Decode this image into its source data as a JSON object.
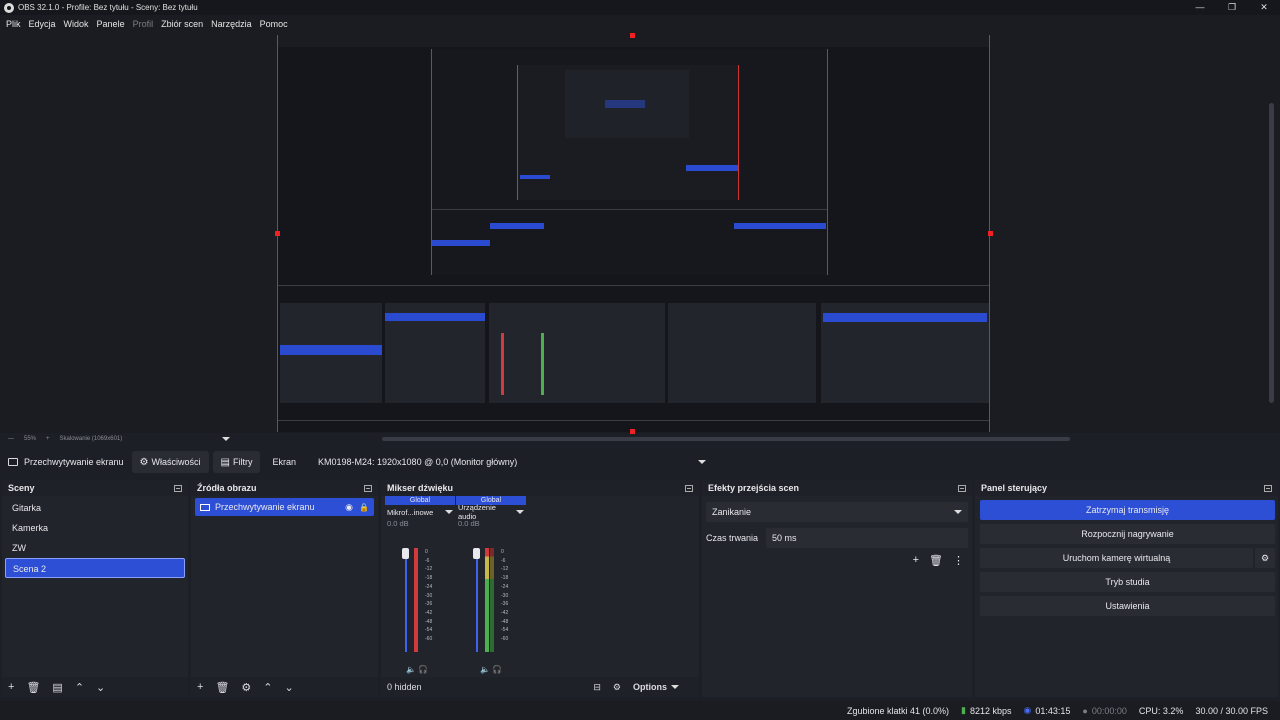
{
  "window": {
    "title": "OBS 32.1.0 - Profile: Bez tytułu - Sceny: Bez tytułu",
    "controls": [
      "—",
      "❐",
      "✕"
    ]
  },
  "menu": [
    {
      "label": "Plik",
      "enabled": true
    },
    {
      "label": "Edycja",
      "enabled": true
    },
    {
      "label": "Widok",
      "enabled": true
    },
    {
      "label": "Panele",
      "enabled": true
    },
    {
      "label": "Profil",
      "enabled": false
    },
    {
      "label": "Zbiór scen",
      "enabled": true
    },
    {
      "label": "Narzędzia",
      "enabled": true
    },
    {
      "label": "Pomoc",
      "enabled": true
    }
  ],
  "preview": {
    "zoom": "55%",
    "scaling": "Skalowanie (1069x601)"
  },
  "toolbar": {
    "source_name": "Przechwytywanie ekranu",
    "properties": "Właściwości",
    "filters": "Filtry",
    "display_label": "Ekran",
    "display_value": "KM0198-M24: 1920x1080 @ 0,0 (Monitor główny)"
  },
  "scenes": {
    "title": "Sceny",
    "items": [
      {
        "label": "Gitarka",
        "active": false
      },
      {
        "label": "Kamerka",
        "active": false
      },
      {
        "label": "ZW",
        "active": false
      },
      {
        "label": "Scena 2",
        "active": true
      }
    ]
  },
  "sources": {
    "title": "Źródła obrazu",
    "items": [
      {
        "label": "Przechwytywanie ekranu"
      }
    ]
  },
  "mixer": {
    "title": "Mikser dźwięku",
    "channels": [
      {
        "head": "Global",
        "name": "Mikrof...inowe",
        "db": "0.0 dB"
      },
      {
        "head": "Global",
        "name": "Urządzenie audio",
        "db": "0.0 dB"
      }
    ],
    "scale": [
      "0",
      "-6",
      "-12",
      "-18",
      "-24",
      "-30",
      "-36",
      "-42",
      "-48",
      "-54",
      "-60"
    ],
    "hidden": "0 hidden",
    "options": "Options"
  },
  "transitions": {
    "title": "Efekty przejścia scen",
    "selected": "Zanikanie",
    "duration_label": "Czas trwania",
    "duration_value": "50 ms"
  },
  "controls": {
    "title": "Panel sterujący",
    "stop_stream": "Zatrzymaj transmisję",
    "start_record": "Rozpocznij nagrywanie",
    "virtual_cam": "Uruchom kamerę wirtualną",
    "studio_mode": "Tryb studia",
    "settings": "Ustawienia"
  },
  "status": {
    "dropped": "Zgubione klatki 41 (0.0%)",
    "bitrate": "8212 kbps",
    "stream_time": "01:43:15",
    "record_time": "00:00:00",
    "cpu": "CPU: 3.2%",
    "fps": "30.00 / 30.00 FPS"
  },
  "colors": {
    "accent": "#2d4fd6",
    "bounding_box": "#dd2222",
    "meter_green": "#4caf50",
    "meter_red": "#d23b3b"
  }
}
